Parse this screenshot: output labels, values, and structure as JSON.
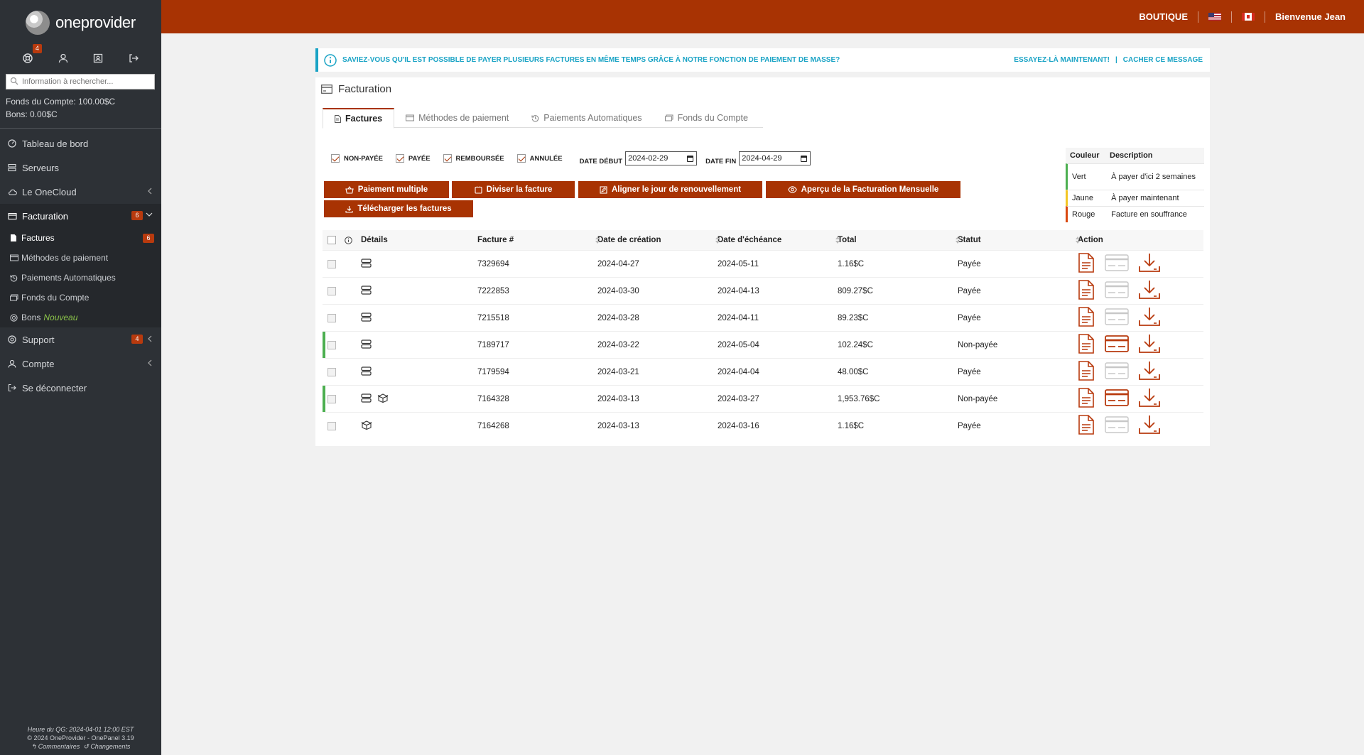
{
  "brand": {
    "name": "oneprovider"
  },
  "sidebar": {
    "notif_badge": "4",
    "search_placeholder": "Information à rechercher...",
    "funds": "Fonds du Compte: 100.00$C",
    "bons": "Bons: 0.00$C",
    "nav": {
      "dashboard": "Tableau de bord",
      "servers": "Serveurs",
      "cloud": "Le OneCloud",
      "billing": "Facturation",
      "billing_badge": "6",
      "support": "Support",
      "support_badge": "4",
      "account": "Compte",
      "logout": "Se déconnecter"
    },
    "sub": {
      "invoices": "Factures",
      "invoices_badge": "6",
      "payment_methods": "Méthodes de paiement",
      "auto_payments": "Paiements Automatiques",
      "account_funds": "Fonds du Compte",
      "vouchers": "Bons",
      "vouchers_new": "Nouveau"
    },
    "footer": {
      "hq_time": "Heure du QG: 2024-04-01 12:00 EST",
      "copyright": "© 2024 OneProvider  -  OnePanel 3.19",
      "comments": "Commentaires",
      "changes": "Changements"
    }
  },
  "topbar": {
    "shop": "BOUTIQUE",
    "welcome": "Bienvenue Jean"
  },
  "banner": {
    "message": "SAVIEZ-VOUS QU'IL EST POSSIBLE DE PAYER PLUSIEURS FACTURES EN MÊME TEMPS GRÂCE À NOTRE FONCTION DE PAIEMENT DE MASSE?",
    "try_now": "ESSAYEZ-LÀ MAINTENANT!",
    "separator": "|",
    "hide": "CACHER CE MESSAGE"
  },
  "panel": {
    "title": "Facturation",
    "tabs": [
      "Factures",
      "Méthodes de paiement",
      "Paiements Automatiques",
      "Fonds du Compte"
    ]
  },
  "filters": {
    "unpaid": "NON-PAYÉE",
    "paid": "PAYÉE",
    "refunded": "REMBOURSÉE",
    "cancelled": "ANNULÉE",
    "start_label": "DATE DÉBUT",
    "start_value": "2024-02-29",
    "end_label": "DATE FIN",
    "end_value": "2024-04-29"
  },
  "buttons": {
    "mass_pay": "Paiement multiple",
    "split": "Diviser la facture",
    "align": "Aligner le jour de renouvellement",
    "preview": "Aperçu de la Facturation Mensuelle",
    "download": "Télécharger les factures"
  },
  "legend": {
    "col_color": "Couleur",
    "col_desc": "Description",
    "rows": [
      {
        "color": "Vert",
        "desc": "À payer d'ici 2 semaines",
        "hex": "#4caf50"
      },
      {
        "color": "Jaune",
        "desc": "À payer maintenant",
        "hex": "#f3c623"
      },
      {
        "color": "Rouge",
        "desc": "Facture en souffrance",
        "hex": "#d9480f"
      }
    ]
  },
  "table": {
    "headers": {
      "details": "Détails",
      "invoice": "Facture #",
      "created": "Date de création",
      "due": "Date d'échéance",
      "total": "Total",
      "status": "Statut",
      "action": "Action"
    },
    "rows": [
      {
        "id": "7329694",
        "created": "2024-04-27",
        "due": "2024-05-11",
        "total": "1.16$C",
        "status": "Payée",
        "icons": [
          "server"
        ],
        "unpaid": false
      },
      {
        "id": "7222853",
        "created": "2024-03-30",
        "due": "2024-04-13",
        "total": "809.27$C",
        "status": "Payée",
        "icons": [
          "server"
        ],
        "unpaid": false
      },
      {
        "id": "7215518",
        "created": "2024-03-28",
        "due": "2024-04-11",
        "total": "89.23$C",
        "status": "Payée",
        "icons": [
          "server"
        ],
        "unpaid": false
      },
      {
        "id": "7189717",
        "created": "2024-03-22",
        "due": "2024-05-04",
        "total": "102.24$C",
        "status": "Non-payée",
        "icons": [
          "server"
        ],
        "unpaid": true
      },
      {
        "id": "7179594",
        "created": "2024-03-21",
        "due": "2024-04-04",
        "total": "48.00$C",
        "status": "Payée",
        "icons": [
          "server"
        ],
        "unpaid": false
      },
      {
        "id": "7164328",
        "created": "2024-03-13",
        "due": "2024-03-27",
        "total": "1,953.76$C",
        "status": "Non-payée",
        "icons": [
          "server",
          "box"
        ],
        "unpaid": true
      },
      {
        "id": "7164268",
        "created": "2024-03-13",
        "due": "2024-03-16",
        "total": "1.16$C",
        "status": "Payée",
        "icons": [
          "box"
        ],
        "unpaid": false
      }
    ]
  },
  "colors": {
    "accent": "#a83303",
    "info": "#19a3c5",
    "sidebar": "#2d3136",
    "unpaid_bar": "#4caf50"
  }
}
